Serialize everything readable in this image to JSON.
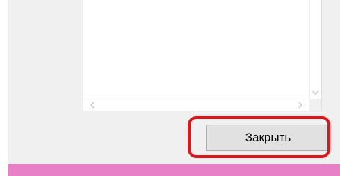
{
  "dialog": {
    "close_button_label": "Закрыть"
  },
  "scrollbars": {
    "vertical_down_arrow": "chevron-down-icon",
    "horizontal_left_arrow": "chevron-left-icon",
    "horizontal_right_arrow": "chevron-right-icon"
  },
  "colors": {
    "window_background": "#f0f0f0",
    "button_background": "#e1e1e1",
    "button_border": "#adadad",
    "highlight": "#e2141a",
    "bottom_bar": "#e880c8"
  }
}
